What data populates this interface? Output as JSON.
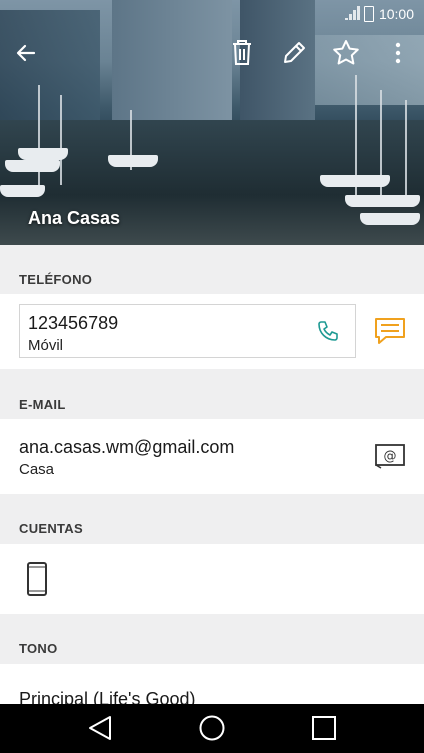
{
  "status": {
    "time": "10:00"
  },
  "contact": {
    "name": "Ana Casas"
  },
  "sections": {
    "phone": {
      "label": "TELÉFONO",
      "number": "123456789",
      "type": "Móvil"
    },
    "email": {
      "label": "E-MAIL",
      "address": "ana.casas.wm@gmail.com",
      "type": "Casa"
    },
    "accounts": {
      "label": "CUENTAS"
    },
    "ringtone": {
      "label": "TONO",
      "value": "Principal (Life's Good)"
    }
  },
  "icons": {
    "back": "arrow-left-icon",
    "delete": "trash-icon",
    "edit": "pencil-icon",
    "favorite": "star-icon",
    "more": "more-vert-icon",
    "call": "phone-icon",
    "message": "message-icon",
    "email": "at-mail-icon",
    "account": "phone-device-icon"
  },
  "colors": {
    "call": "#1e9a93",
    "message": "#f0a11e",
    "navbar": "#000000"
  }
}
